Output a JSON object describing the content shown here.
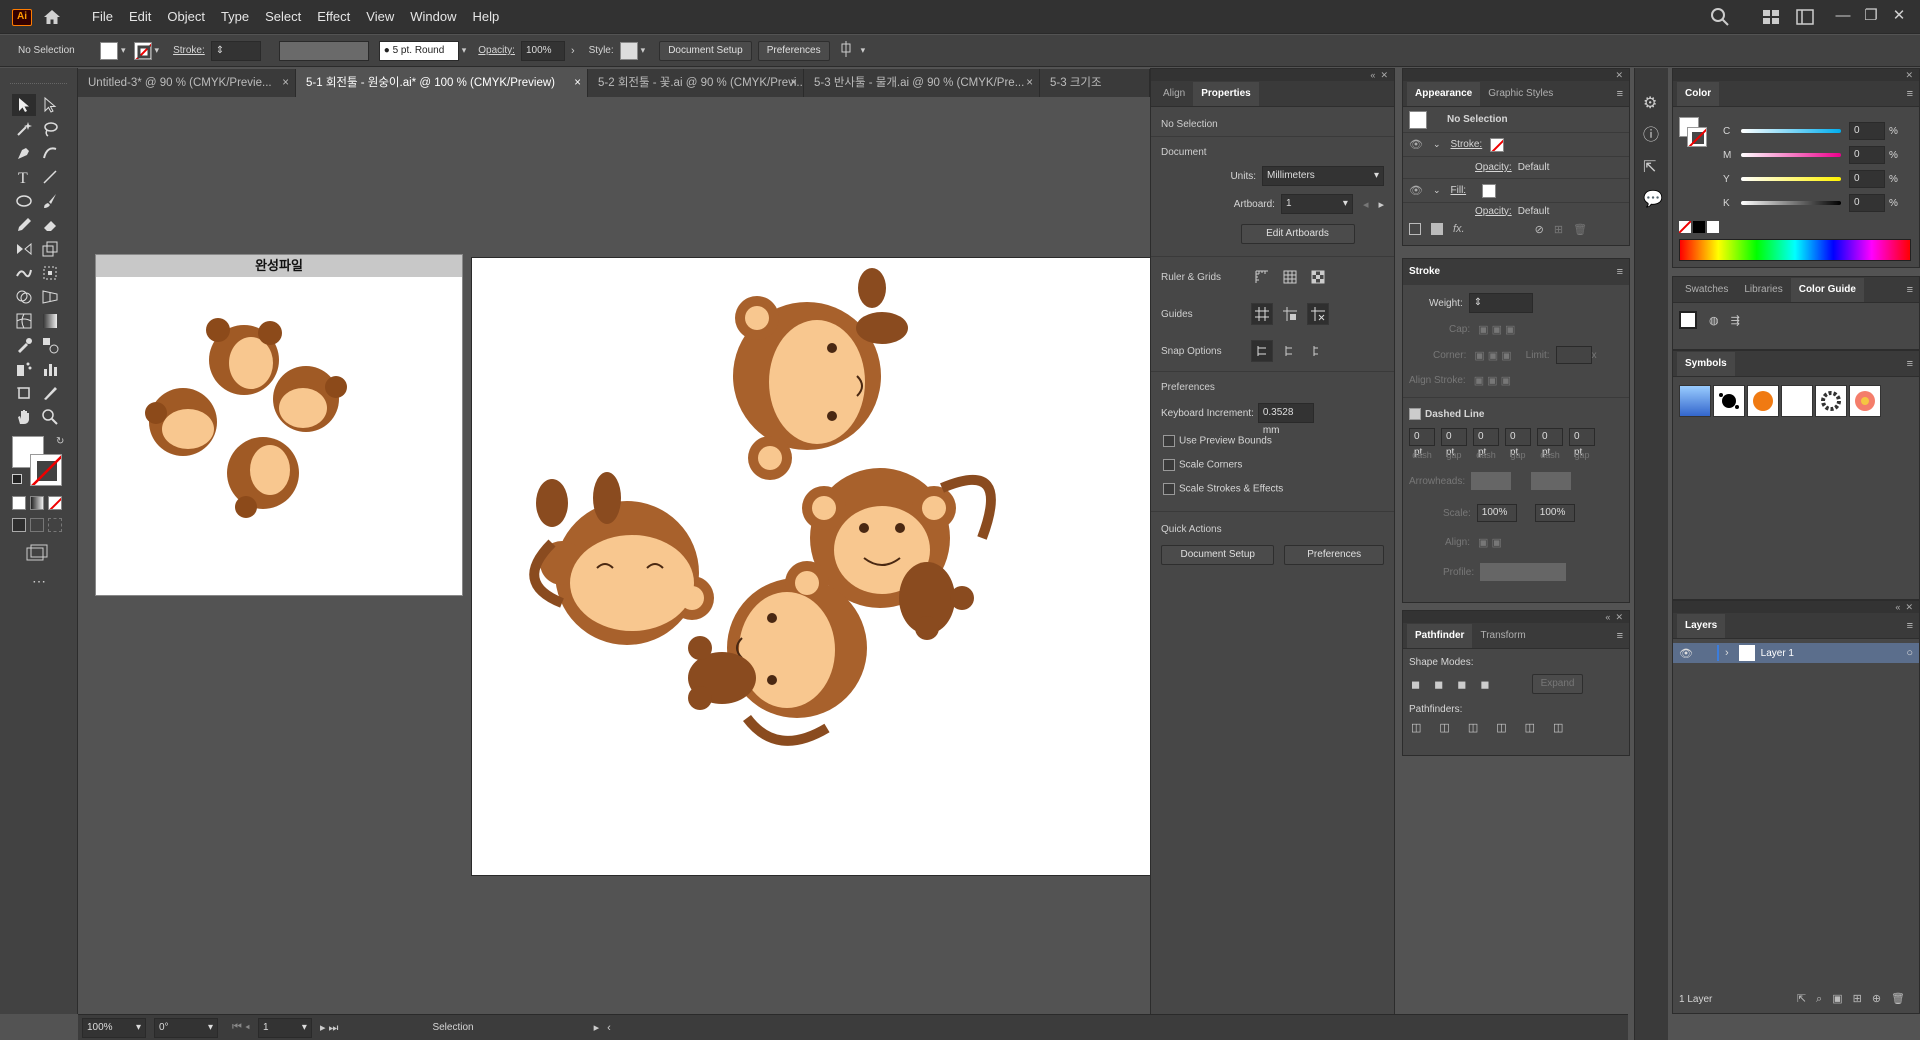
{
  "app": {
    "logo": "Ai",
    "icon": "home-icon"
  },
  "menu": [
    "File",
    "Edit",
    "Object",
    "Type",
    "Select",
    "Effect",
    "View",
    "Window",
    "Help"
  ],
  "control_bar": {
    "selection": "No Selection",
    "stroke_label": "Stroke:",
    "brush": "5 pt. Round",
    "opacity_label": "Opacity:",
    "opacity_value": "100%",
    "style_label": "Style:",
    "document_setup": "Document Setup",
    "preferences": "Preferences"
  },
  "tabs": [
    {
      "label": "Untitled-3* @ 90 % (CMYK/Previe...",
      "active": false
    },
    {
      "label": "5-1 회전툴 - 원숭이.ai* @ 100 % (CMYK/Preview)",
      "active": true
    },
    {
      "label": "5-2 회전툴 - 꽃.ai @ 90 % (CMYK/Previ...",
      "active": false
    },
    {
      "label": "5-3 반사툴 - 물개.ai @ 90 % (CMYK/Pre...",
      "active": false
    },
    {
      "label": "5-3 크기조",
      "active": false
    }
  ],
  "canvas": {
    "small_artboard_title": "완성파일"
  },
  "properties_panel": {
    "tabs": [
      "Align",
      "Properties"
    ],
    "selection": "No Selection",
    "document_label": "Document",
    "units_label": "Units:",
    "units_value": "Millimeters",
    "artboard_label": "Artboard:",
    "artboard_value": "1",
    "edit_artboards": "Edit Artboards",
    "ruler_grids": "Ruler & Grids",
    "guides": "Guides",
    "snap_options": "Snap Options",
    "preferences_label": "Preferences",
    "keyboard_increment_label": "Keyboard Increment:",
    "keyboard_increment_value": "0.3528 mm",
    "checkboxes": [
      "Use Preview Bounds",
      "Scale Corners",
      "Scale Strokes & Effects"
    ],
    "quick_actions": "Quick Actions",
    "document_setup": "Document Setup",
    "preferences_btn": "Preferences"
  },
  "appearance_panel": {
    "tabs": [
      "Appearance",
      "Graphic Styles"
    ],
    "selection": "No Selection",
    "stroke_label": "Stroke:",
    "opacity_label": "Opacity:",
    "opacity_value": "Default",
    "fill_label": "Fill:",
    "opacity2_label": "Opacity:",
    "opacity2_value": "Default",
    "fx": "fx."
  },
  "stroke_panel": {
    "title": "Stroke",
    "weight_label": "Weight:",
    "cap_label": "Cap:",
    "corner_label": "Corner:",
    "limit_label": "Limit:",
    "limit_x": "x",
    "align_label": "Align Stroke:",
    "dashed_line": "Dashed Line",
    "dash_values": [
      "0 pt",
      "0 pt",
      "0 pt",
      "0 pt",
      "0 pt",
      "0 pt"
    ],
    "dash_labels": [
      "dash",
      "gap",
      "dash",
      "gap",
      "dash",
      "gap"
    ],
    "arrowheads_label": "Arrowheads:",
    "scale_label": "Scale:",
    "scale1": "100%",
    "scale2": "100%",
    "align2_label": "Align:",
    "profile_label": "Profile:"
  },
  "pathfinder_panel": {
    "tabs": [
      "Pathfinder",
      "Transform"
    ],
    "shape_modes": "Shape Modes:",
    "expand": "Expand",
    "pathfinders": "Pathfinders:"
  },
  "color_panel": {
    "title": "Color",
    "channels": [
      {
        "label": "C",
        "value": "0",
        "unit": "%",
        "color": "#00aeef"
      },
      {
        "label": "M",
        "value": "0",
        "unit": "%",
        "color": "#ec008c"
      },
      {
        "label": "Y",
        "value": "0",
        "unit": "%",
        "color": "#fff200"
      },
      {
        "label": "K",
        "value": "0",
        "unit": "%",
        "color": "#000000"
      }
    ]
  },
  "swatch_tabs": [
    "Swatches",
    "Libraries",
    "Color Guide"
  ],
  "symbols_panel": {
    "title": "Symbols"
  },
  "layers_panel": {
    "title": "Layers",
    "layer_name": "Layer 1",
    "count": "1 Layer"
  },
  "status_bar": {
    "zoom": "100%",
    "rotation": "0°",
    "artboard": "1",
    "tool": "Selection"
  }
}
